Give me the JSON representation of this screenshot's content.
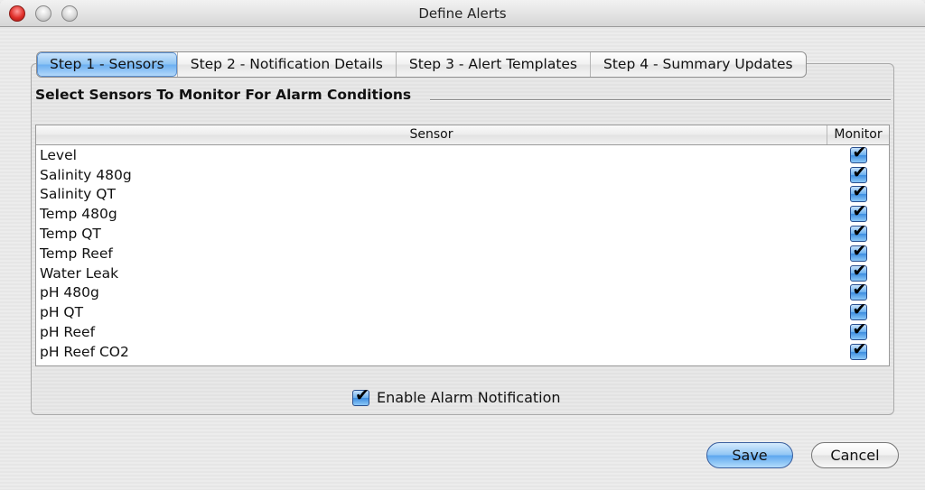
{
  "window": {
    "title": "Define Alerts"
  },
  "tabs": [
    {
      "label": "Step 1 - Sensors",
      "active": true
    },
    {
      "label": "Step 2 - Notification Details",
      "active": false
    },
    {
      "label": "Step 3 - Alert Templates",
      "active": false
    },
    {
      "label": "Step 4 - Summary Updates",
      "active": false
    }
  ],
  "section": {
    "title": "Select Sensors To Monitor For Alarm Conditions"
  },
  "table": {
    "columns": [
      "Sensor",
      "Monitor"
    ],
    "rows": [
      {
        "sensor": "Level",
        "monitor": true
      },
      {
        "sensor": "Salinity 480g",
        "monitor": true
      },
      {
        "sensor": "Salinity QT",
        "monitor": true
      },
      {
        "sensor": "Temp 480g",
        "monitor": true
      },
      {
        "sensor": "Temp QT",
        "monitor": true
      },
      {
        "sensor": "Temp Reef",
        "monitor": true
      },
      {
        "sensor": "Water Leak",
        "monitor": true
      },
      {
        "sensor": "pH 480g",
        "monitor": true
      },
      {
        "sensor": "pH QT",
        "monitor": true
      },
      {
        "sensor": "pH Reef",
        "monitor": true
      },
      {
        "sensor": "pH Reef CO2",
        "monitor": true
      }
    ]
  },
  "enable_alarm": {
    "label": "Enable Alarm Notification",
    "checked": true
  },
  "buttons": {
    "save": "Save",
    "cancel": "Cancel"
  }
}
